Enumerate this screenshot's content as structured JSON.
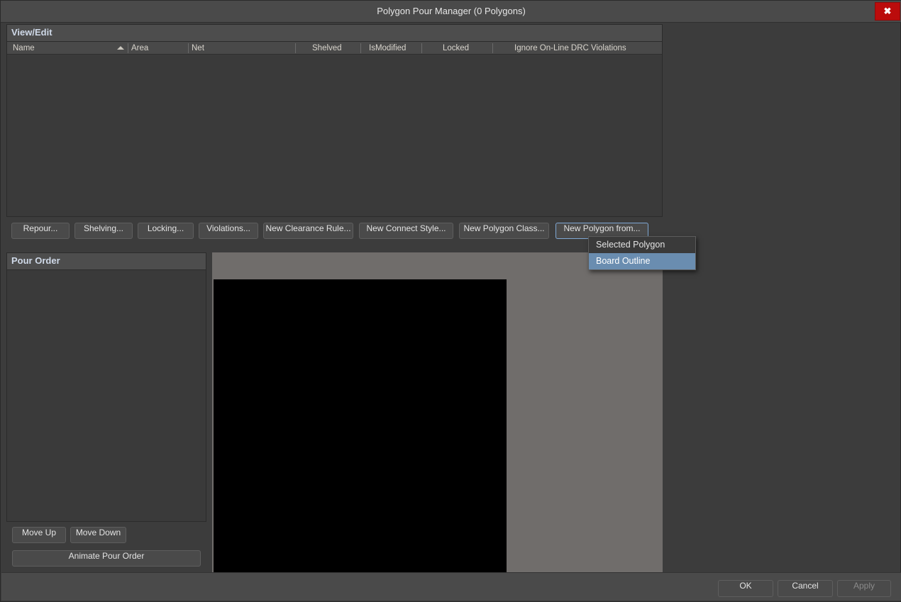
{
  "window": {
    "title": "Polygon Pour Manager (0 Polygons)",
    "close_icon": "close-icon",
    "close_glyph": "✖"
  },
  "view_edit": {
    "header": "View/Edit",
    "columns": [
      {
        "label": "Name",
        "sorted": true,
        "sort_dir": "asc"
      },
      {
        "label": "Area",
        "sorted": false
      },
      {
        "label": "Net",
        "sorted": false
      },
      {
        "label": "Shelved",
        "sorted": false
      },
      {
        "label": "IsModified",
        "sorted": false
      },
      {
        "label": "Locked",
        "sorted": false
      },
      {
        "label": "Ignore On-Line DRC Violations",
        "sorted": false
      }
    ],
    "rows": []
  },
  "toolbar": {
    "buttons": [
      {
        "label": "Repour...",
        "state": "normal"
      },
      {
        "label": "Shelving...",
        "state": "normal"
      },
      {
        "label": "Locking...",
        "state": "normal"
      },
      {
        "label": "Violations...",
        "state": "normal"
      },
      {
        "label": "New Clearance Rule...",
        "state": "normal"
      },
      {
        "label": "New Connect Style...",
        "state": "normal"
      },
      {
        "label": "New Polygon Class...",
        "state": "normal"
      },
      {
        "label": "New Polygon from...",
        "state": "focused"
      }
    ]
  },
  "dropdown": {
    "open": true,
    "items": [
      {
        "label": "Selected Polygon",
        "selected": false
      },
      {
        "label": "Board Outline",
        "selected": true
      }
    ]
  },
  "pour_order": {
    "header": "Pour Order",
    "items": [],
    "move_up_label": "Move Up",
    "move_down_label": "Move Down",
    "animate_label": "Animate Pour Order"
  },
  "preview": {
    "background_color": "#706d6b",
    "board_color": "#000000"
  },
  "footer": {
    "ok_label": "OK",
    "cancel_label": "Cancel",
    "apply_label": "Apply",
    "apply_enabled": false
  },
  "colors": {
    "accent": "#6a8db0",
    "heading": "#cfd9e8",
    "close_red": "#bb0c0c",
    "window_bg": "#3c3c3c",
    "titlebar_bg": "#4a4a4a"
  }
}
